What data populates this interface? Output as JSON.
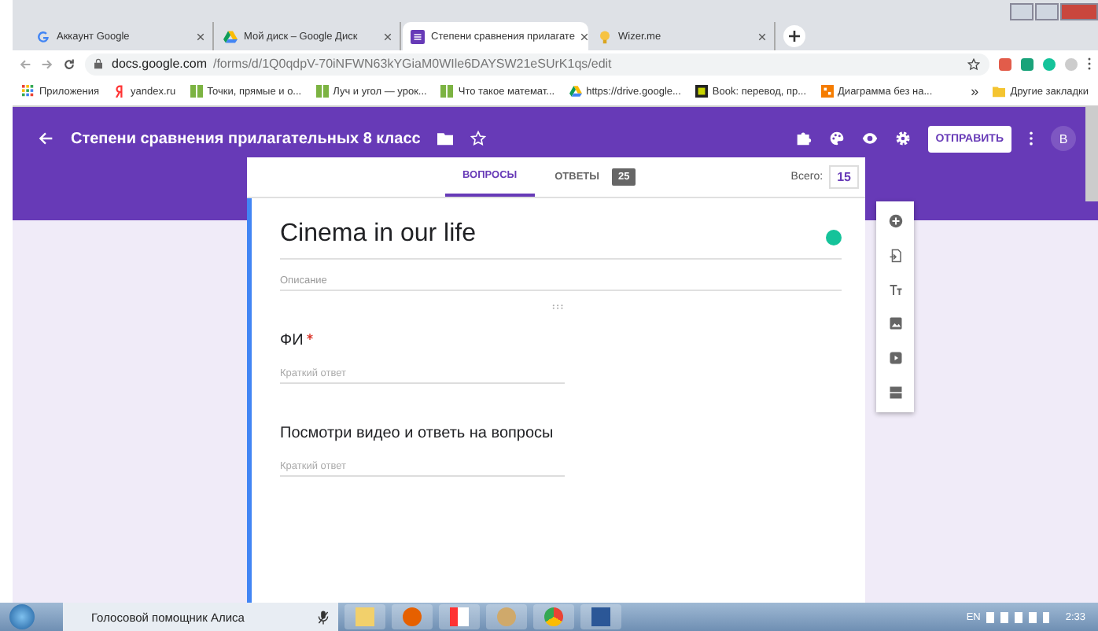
{
  "browser": {
    "tabs": [
      {
        "title": "Аккаунт Google",
        "selected": false
      },
      {
        "title": "Мой диск – Google Диск",
        "selected": false
      },
      {
        "title": "Степени сравнения прилагате",
        "selected": true
      },
      {
        "title": "Wizer.me",
        "selected": false
      }
    ],
    "url_host": "docs.google.com",
    "url_path": "/forms/d/1Q0qdpV-70iNFWN63kYGiaM0WIle6DAYSW21eSUrK1qs/edit",
    "bookmarks": [
      "Приложения",
      "yandex.ru",
      "Точки, прямые и о...",
      "Луч и угол — урок...",
      "Что такое математ...",
      "https://drive.google...",
      "Book: перевод, пр...",
      "Диаграмма без на..."
    ],
    "more_bookmarks": "»",
    "other_bookmarks": "Другие закладки"
  },
  "app_bar": {
    "title": "Степени сравнения прилагательных 8 класс",
    "send_button": "ОТПРАВИТЬ",
    "avatar": "B"
  },
  "form_tabs": [
    {
      "label": "ВОПРОСЫ",
      "selected": true
    },
    {
      "label": "ОТВЕТЫ",
      "selected": false,
      "badge": "25"
    }
  ],
  "total_label": "Всего:",
  "total_value": "15",
  "form": {
    "title": "Cinema in our life",
    "description_placeholder": "Описание"
  },
  "questions": [
    {
      "title": "ФИ",
      "required": true,
      "placeholder": "Краткий ответ"
    },
    {
      "title": "Посмотри видео и ответь на вопросы",
      "required": false,
      "placeholder": "Краткий ответ"
    }
  ],
  "taskbar": {
    "assistant": "Голосовой помощник Алиса",
    "lang": "EN",
    "time": "2:33"
  }
}
